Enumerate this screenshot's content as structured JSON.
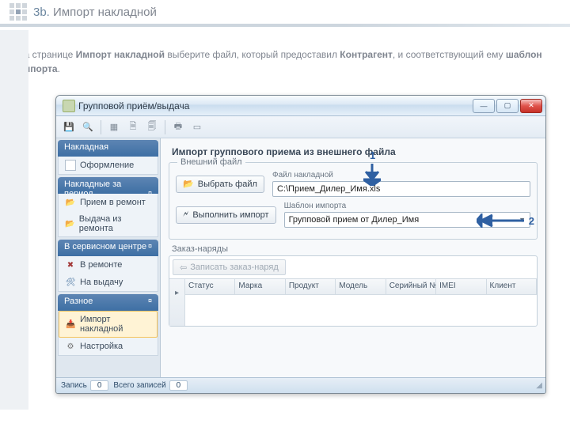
{
  "slide": {
    "step_prefix": "3b. ",
    "step_title": "Импорт накладной",
    "instruction_pre": "На странице ",
    "instruction_b1": "Импорт накладной",
    "instruction_mid": " выберите файл, который предоставил ",
    "instruction_b2": "Контрагент",
    "instruction_mid2": ", и соответствующий ему ",
    "instruction_b3": "шаблон импорта",
    "instruction_post": "."
  },
  "window": {
    "title": "Групповой приём/выдача"
  },
  "winbuttons": {
    "min": "—",
    "max": "▢",
    "close": "✕"
  },
  "sidebar": {
    "h1": "Накладная",
    "g1": {
      "i1": "Оформление"
    },
    "h2": "Накладные за период",
    "g2": {
      "i1": "Прием в ремонт",
      "i2": "Выдача из ремонта"
    },
    "h3": "В сервисном центре",
    "g3": {
      "i1": "В ремонте",
      "i2": "На выдачу"
    },
    "h4": "Разное",
    "g4": {
      "i1": "Импорт накладной",
      "i2": "Настройка"
    }
  },
  "main": {
    "title": "Импорт группового приема из внешнего файла",
    "fs_label": "Внешний файл",
    "btn_pick": "Выбрать файл",
    "btn_run": "Выполнить импорт",
    "file_label": "Файл накладной",
    "file_value": "C:\\Прием_Дилер_Имя.xls",
    "tmpl_label": "Шаблон импорта",
    "tmpl_value": "Групповой прием от Дилер_Имя",
    "orders_label": "Заказ-наряды",
    "btn_write": "Записать заказ-наряд",
    "cols": {
      "c1": "Статус",
      "c2": "Марка",
      "c3": "Продукт",
      "c4": "Модель",
      "c5": "Серийный №",
      "c6": "IMEI",
      "c7": "Клиент"
    }
  },
  "status": {
    "rec_label": "Запись",
    "rec_val": "0",
    "total_label": "Всего записей",
    "total_val": "0"
  },
  "annot": {
    "a1": "1",
    "a2": "2"
  }
}
